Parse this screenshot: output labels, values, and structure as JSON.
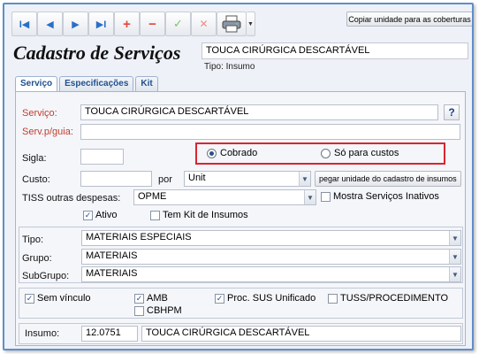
{
  "header": {
    "title": "Cadastro de Serviços",
    "service_name": "TOUCA CIRÚRGICA DESCARTÁVEL",
    "type_line": "Tipo: Insumo",
    "copy_button": "Copiar unidade para as coberturas"
  },
  "toolbar": {
    "first": "I◀",
    "prev": "◀",
    "next": "▶",
    "last": "▶I",
    "add": "+",
    "remove": "−",
    "confirm": "✓",
    "cancel": "✕",
    "print_dropdown": "▼"
  },
  "tabs": [
    "Serviço",
    "Especificações",
    "Kit"
  ],
  "form": {
    "servico_label": "Serviço:",
    "servico_value": "TOUCA CIRÚRGICA DESCARTÁVEL",
    "help_label": "?",
    "serv_guia_label": "Serv.p/guia:",
    "serv_guia_value": "",
    "sigla_label": "Sigla:",
    "sigla_value": "",
    "radio_cobrado": "Cobrado",
    "radio_custos": "Só para custos",
    "custo_label": "Custo:",
    "custo_value": "",
    "por_label": "por",
    "unit_value": "Unit",
    "unit_button": "pegar unidade do cadastro de insumos",
    "tiss_label": "TISS outras despesas:",
    "tiss_value": "OPME",
    "mostra_inativos": "Mostra Serviços Inativos",
    "ativo": "Ativo",
    "kit_insumos": "Tem Kit de Insumos",
    "tipo_label": "Tipo:",
    "tipo_value": "MATERIAIS ESPECIAIS",
    "grupo_label": "Grupo:",
    "grupo_value": "MATERIAIS",
    "subgrupo_label": "SubGrupo:",
    "subgrupo_value": "MATERIAIS",
    "sem_vinculo": "Sem vínculo",
    "amb": "AMB",
    "cbhpm": "CBHPM",
    "proc_sus": "Proc. SUS Unificado",
    "tuss": "TUSS/PROCEDIMENTO",
    "insumo_label": "Insumo:",
    "insumo_code": "12.0751",
    "insumo_name": "TOUCA CIRÚRGICA DESCARTÁVEL"
  },
  "checkbox_mark": "✓",
  "select_arrow": "▼",
  "colors": {
    "frame_border": "#5f8ec9",
    "highlight_box": "#d9262f",
    "required_label": "#c43c2c",
    "tab_text": "#1f4f8f"
  }
}
